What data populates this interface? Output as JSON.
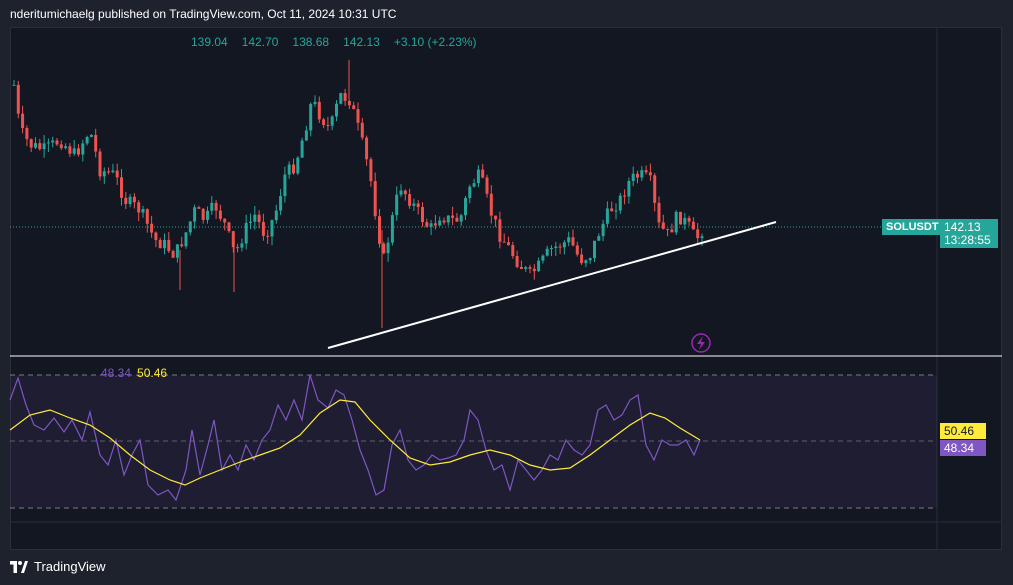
{
  "header": {
    "published_text": "nderitumichaelg published on TradingView.com, Oct 11, 2024 10:31 UTC"
  },
  "ohlc": {
    "open": "139.04",
    "high": "142.70",
    "low": "138.68",
    "close": "142.13",
    "change": "+3.10 (+2.23%)"
  },
  "price_scale": {
    "symbol": "SOLUSDT",
    "last_price": "142.13",
    "countdown": "13:28:55"
  },
  "rsi": {
    "rsi_value": "48.34",
    "ma_value": "50.46"
  },
  "footer": {
    "brand": "TradingView"
  },
  "colors": {
    "up": "#26a69a",
    "down": "#ef5350",
    "rsi": "#7e57c2",
    "rsi_ma": "#ffeb3b",
    "background": "#131722",
    "frame": "#1e222d"
  },
  "icons": [
    "lightning-icon",
    "tradingview-logo-icon"
  ]
}
